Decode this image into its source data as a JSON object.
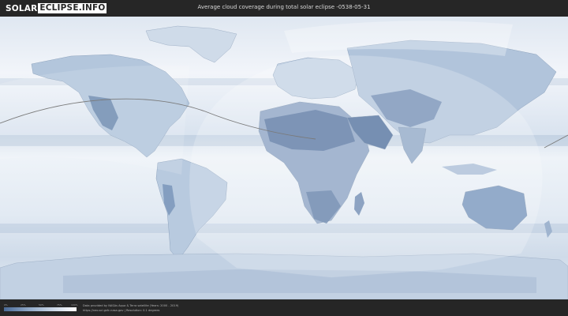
{
  "header": {
    "logo_part1": "SOLAR",
    "logo_part2": "ECLIPSE.INFO",
    "title": "Average cloud coverage during total solar eclipse -0538-05-31"
  },
  "legend": {
    "ticks": [
      "0%",
      "25%",
      "50%",
      "75%",
      "100%"
    ],
    "colors": [
      "#4a6a96",
      "#8ea7c6",
      "#c9d6e6",
      "#ffffff"
    ]
  },
  "footer": {
    "credit_line1": "Data provided by NASAs Aqua & Terra satellite (Years: 2000 - 2019)",
    "credit_line2": "https://neo.sci.gsfc.nasa.gov | Resolution: 0.1 degrees"
  },
  "colors": {
    "ocean": "#e7eef6",
    "land_dark": "#5f7ea8",
    "land_light": "#b6c8de",
    "eclipse_path": "#7a7a7a",
    "background": "#262626"
  }
}
